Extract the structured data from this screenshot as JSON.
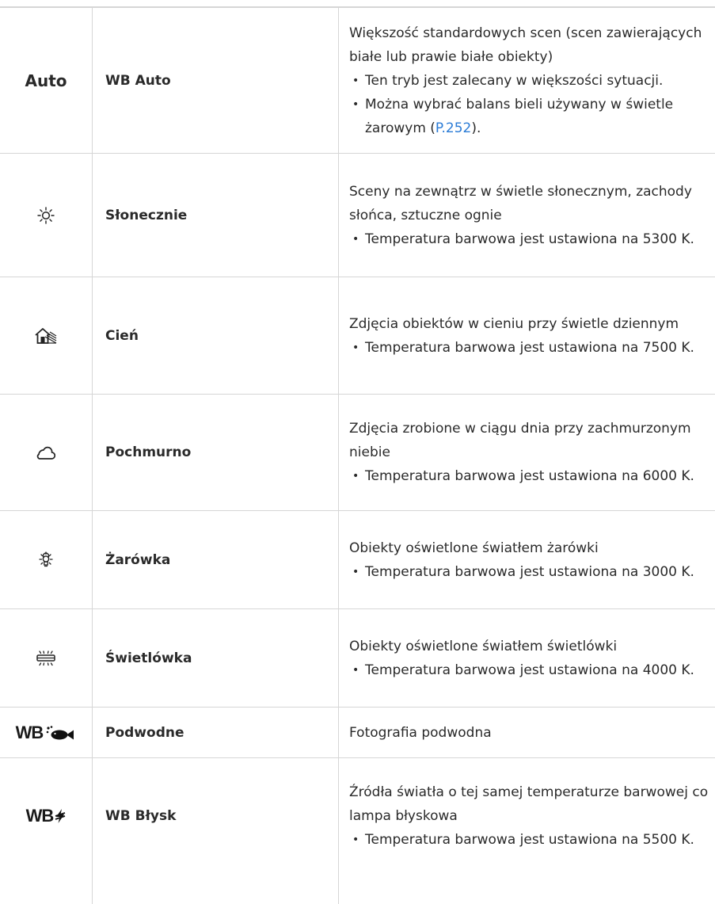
{
  "rows": [
    {
      "mode_label": "Auto",
      "name": "WB Auto",
      "description": "Większość standardowych scen (scen zawierających białe lub prawie białe obiekty)",
      "bullets": [
        "Ten tryb jest zalecany w większości sytuacji."
      ],
      "bullet2_prefix": "Można wybrać balans bieli używany w świetle żarowym (",
      "bullet2_link": "P.252",
      "bullet2_suffix": ")."
    },
    {
      "icon": "sun-icon",
      "name": "Słonecznie",
      "description": "Sceny na zewnątrz w świetle słonecznym, zachody słońca, sztuczne ognie",
      "bullets": [
        "Temperatura barwowa jest ustawiona na 5300 K."
      ]
    },
    {
      "icon": "shade-icon",
      "name": "Cień",
      "description": "Zdjęcia obiektów w cieniu przy świetle dziennym",
      "bullets": [
        "Temperatura barwowa jest ustawiona na 7500 K."
      ]
    },
    {
      "icon": "cloud-icon",
      "name": "Pochmurno",
      "description": "Zdjęcia zrobione w ciągu dnia przy zachmurzonym niebie",
      "bullets": [
        "Temperatura barwowa jest ustawiona na 6000 K."
      ]
    },
    {
      "icon": "incandescent-bulb-icon",
      "name": "Żarówka",
      "description": "Obiekty oświetlone światłem żarówki",
      "bullets": [
        "Temperatura barwowa jest ustawiona na 3000 K."
      ]
    },
    {
      "icon": "fluorescent-lamp-icon",
      "name": "Świetlówka",
      "description": "Obiekty oświetlone światłem świetlówki",
      "bullets": [
        "Temperatura barwowa jest ustawiona na 4000 K."
      ]
    },
    {
      "icon": "underwater-wb-icon",
      "icon_text": "WB",
      "name": "Podwodne",
      "description": "Fotografia podwodna"
    },
    {
      "icon": "flash-wb-icon",
      "icon_text": "WB",
      "name": "WB Błysk",
      "description": "Źródła światła o tej samej temperaturze barwowej co lampa błyskowa",
      "bullets": [
        "Temperatura barwowa jest ustawiona na 5500 K."
      ]
    }
  ],
  "colors": {
    "link": "#2a7bd6",
    "border": "#d6d6d6",
    "text": "#2a2a2a"
  }
}
